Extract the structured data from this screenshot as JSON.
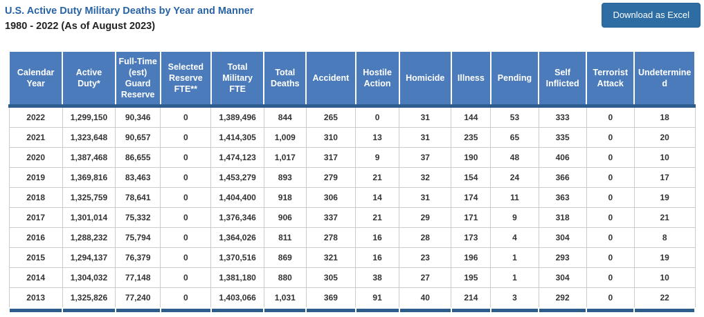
{
  "header": {
    "title": "U.S. Active Duty Military Deaths by Year and Manner",
    "subtitle": "1980 - 2022 (As of August 2023)",
    "download_button": "Download as Excel"
  },
  "table": {
    "columns": [
      "Calendar Year",
      "Active Duty*",
      "Full-Time (est) Guard Reserve",
      "Selected Reserve FTE**",
      "Total Military FTE",
      "Total Deaths",
      "Accident",
      "Hostile Action",
      "Homicide",
      "Illness",
      "Pending",
      "Self Inflicted",
      "Terrorist Attack",
      "Undetermined"
    ],
    "rows": [
      [
        "2022",
        "1,299,150",
        "90,346",
        "0",
        "1,389,496",
        "844",
        "265",
        "0",
        "31",
        "144",
        "53",
        "333",
        "0",
        "18"
      ],
      [
        "2021",
        "1,323,648",
        "90,657",
        "0",
        "1,414,305",
        "1,009",
        "310",
        "13",
        "31",
        "235",
        "65",
        "335",
        "0",
        "20"
      ],
      [
        "2020",
        "1,387,468",
        "86,655",
        "0",
        "1,474,123",
        "1,017",
        "317",
        "9",
        "37",
        "190",
        "48",
        "406",
        "0",
        "10"
      ],
      [
        "2019",
        "1,369,816",
        "83,463",
        "0",
        "1,453,279",
        "893",
        "279",
        "21",
        "32",
        "154",
        "24",
        "366",
        "0",
        "17"
      ],
      [
        "2018",
        "1,325,759",
        "78,641",
        "0",
        "1,404,400",
        "918",
        "306",
        "14",
        "31",
        "174",
        "11",
        "363",
        "0",
        "19"
      ],
      [
        "2017",
        "1,301,014",
        "75,332",
        "0",
        "1,376,346",
        "906",
        "337",
        "21",
        "29",
        "171",
        "9",
        "318",
        "0",
        "21"
      ],
      [
        "2016",
        "1,288,232",
        "75,794",
        "0",
        "1,364,026",
        "811",
        "278",
        "16",
        "28",
        "173",
        "4",
        "304",
        "0",
        "8"
      ],
      [
        "2015",
        "1,294,137",
        "76,379",
        "0",
        "1,370,516",
        "869",
        "321",
        "16",
        "23",
        "196",
        "1",
        "293",
        "0",
        "19"
      ],
      [
        "2014",
        "1,304,032",
        "77,148",
        "0",
        "1,381,180",
        "880",
        "305",
        "38",
        "27",
        "195",
        "1",
        "304",
        "0",
        "10"
      ],
      [
        "2013",
        "1,325,826",
        "77,240",
        "0",
        "1,403,066",
        "1,031",
        "369",
        "91",
        "40",
        "214",
        "3",
        "292",
        "0",
        "22"
      ]
    ]
  },
  "colors": {
    "title_text": "#2763a5",
    "header_bg": "#4b7bba",
    "header_border": "#2c5d8c",
    "button_bg": "#2e6da4",
    "cell_border": "#cbcbcb"
  }
}
